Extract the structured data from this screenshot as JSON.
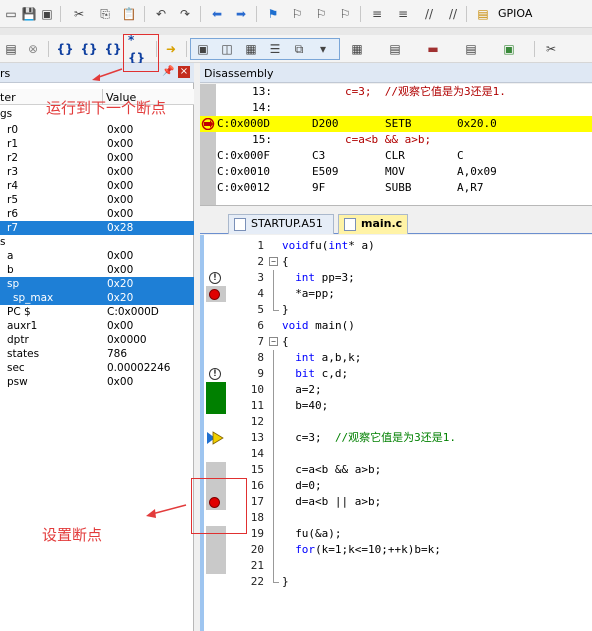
{
  "toolbar1": {
    "target_name": "GPIOA",
    "icons": [
      "new-file-icon",
      "save-icon",
      "save-all-icon",
      "cut-icon",
      "copy-icon",
      "paste-icon",
      "undo-icon",
      "redo-icon",
      "nav-back-icon",
      "nav-forward-icon",
      "bookmark-icon",
      "bookmark-prev-icon",
      "bookmark-next-icon",
      "bookmark-clear-icon",
      "indent-icon",
      "unindent-icon",
      "comment-icon",
      "uncomment-icon",
      "project-icon"
    ]
  },
  "toolbar2": {
    "icons": [
      "reset-icon",
      "stop-icon",
      "step-into-icon",
      "step-over-icon",
      "step-out-icon",
      "run-to-cursor-icon",
      "show-next-statement-icon",
      "command-window-icon",
      "disassembly-window-icon",
      "symbols-window-icon",
      "registers-window-icon",
      "call-stack-icon",
      "watch-window-icon",
      "memory-window-icon",
      "serial-window-icon",
      "logic-analyzer-icon",
      "trace-icon",
      "system-viewer-icon",
      "toolbox-icon"
    ],
    "step_symbols": [
      "{}",
      "{}",
      "{}",
      "*{}"
    ]
  },
  "registers": {
    "title": "rs",
    "col_name": "ter",
    "col_value": "Value",
    "section_label": "gs",
    "rows": [
      {
        "name": "r0",
        "value": "0x00",
        "sel": false,
        "indent": 7
      },
      {
        "name": "r1",
        "value": "0x00",
        "sel": false,
        "indent": 7
      },
      {
        "name": "r2",
        "value": "0x00",
        "sel": false,
        "indent": 7
      },
      {
        "name": "r3",
        "value": "0x00",
        "sel": false,
        "indent": 7
      },
      {
        "name": "r4",
        "value": "0x00",
        "sel": false,
        "indent": 7
      },
      {
        "name": "r5",
        "value": "0x00",
        "sel": false,
        "indent": 7
      },
      {
        "name": "r6",
        "value": "0x00",
        "sel": false,
        "indent": 7
      },
      {
        "name": "r7",
        "value": "0x28",
        "sel": true,
        "indent": 7
      },
      {
        "name": "s",
        "value": "",
        "sel": false,
        "indent": 0
      },
      {
        "name": "a",
        "value": "0x00",
        "sel": false,
        "indent": 7
      },
      {
        "name": "b",
        "value": "0x00",
        "sel": false,
        "indent": 7
      },
      {
        "name": "sp",
        "value": "0x20",
        "sel": true,
        "indent": 7
      },
      {
        "name": "sp_max",
        "value": "0x20",
        "sel": true,
        "indent": 13
      },
      {
        "name": "PC  $",
        "value": "C:0x000D",
        "sel": false,
        "indent": 7
      },
      {
        "name": "auxr1",
        "value": "0x00",
        "sel": false,
        "indent": 7
      },
      {
        "name": "dptr",
        "value": "0x0000",
        "sel": false,
        "indent": 7
      },
      {
        "name": "states",
        "value": "786",
        "sel": false,
        "indent": 7
      },
      {
        "name": "sec",
        "value": "0.00002246",
        "sel": false,
        "indent": 7
      },
      {
        "name": "psw",
        "value": "0x00",
        "sel": false,
        "indent": 7
      }
    ]
  },
  "disassembly": {
    "title": "Disassembly",
    "rows": [
      {
        "kind": "src",
        "ln": "13:",
        "text": "c=3;  //观察它值是为3还是1."
      },
      {
        "kind": "src",
        "ln": "14:",
        "text": ""
      },
      {
        "kind": "asm",
        "addr": "C:0x000D",
        "hex": "D200",
        "mn": "SETB",
        "op": "0x20.0",
        "cur": true
      },
      {
        "kind": "src",
        "ln": "15:",
        "text": "c=a<b && a>b;"
      },
      {
        "kind": "asm",
        "addr": "C:0x000F",
        "hex": "C3",
        "mn": "CLR",
        "op": "C",
        "cur": false
      },
      {
        "kind": "asm",
        "addr": "C:0x0010",
        "hex": "E509",
        "mn": "MOV",
        "op": "A,0x09",
        "cur": false
      },
      {
        "kind": "asm",
        "addr": "C:0x0012",
        "hex": "9F",
        "mn": "SUBB",
        "op": "A,R7",
        "cur": false
      }
    ]
  },
  "tabs": [
    {
      "label": "STARTUP.A51",
      "active": false
    },
    {
      "label": "main.c",
      "active": true
    }
  ],
  "code": [
    {
      "ln": "1",
      "html_parts": [
        [
          "kw",
          "void"
        ],
        [
          "",
          "fu("
        ],
        [
          "kw",
          "int"
        ],
        [
          "",
          "* a)"
        ]
      ],
      "mark": "",
      "cov": "",
      "fold": "",
      "indent": 0
    },
    {
      "ln": "2",
      "html_parts": [
        [
          "",
          "{"
        ]
      ],
      "mark": "",
      "cov": "",
      "fold": "open",
      "indent": 0
    },
    {
      "ln": "3",
      "html_parts": [
        [
          "kw",
          "int"
        ],
        [
          "",
          " pp=3;"
        ]
      ],
      "mark": "warn",
      "cov": "",
      "fold": "line",
      "indent": 2
    },
    {
      "ln": "4",
      "html_parts": [
        [
          "",
          "*a=pp;"
        ]
      ],
      "mark": "bp",
      "cov": "gray",
      "fold": "line",
      "indent": 2
    },
    {
      "ln": "5",
      "html_parts": [
        [
          "",
          "}"
        ]
      ],
      "mark": "",
      "cov": "",
      "fold": "end",
      "indent": 0
    },
    {
      "ln": "6",
      "html_parts": [
        [
          "kw",
          "void"
        ],
        [
          "",
          " main()"
        ]
      ],
      "mark": "",
      "cov": "",
      "fold": "",
      "indent": 0
    },
    {
      "ln": "7",
      "html_parts": [
        [
          "",
          "{"
        ]
      ],
      "mark": "",
      "cov": "",
      "fold": "open",
      "indent": 0
    },
    {
      "ln": "8",
      "html_parts": [
        [
          "kw",
          "int"
        ],
        [
          "",
          " a,b,k;"
        ]
      ],
      "mark": "",
      "cov": "",
      "fold": "line",
      "indent": 2
    },
    {
      "ln": "9",
      "html_parts": [
        [
          "kw",
          "bit"
        ],
        [
          "",
          " c,d;"
        ]
      ],
      "mark": "warn",
      "cov": "",
      "fold": "line",
      "indent": 2
    },
    {
      "ln": "10",
      "html_parts": [
        [
          "",
          "a=2;"
        ]
      ],
      "mark": "",
      "cov": "green",
      "fold": "line",
      "indent": 2
    },
    {
      "ln": "11",
      "html_parts": [
        [
          "",
          "b=40;"
        ]
      ],
      "mark": "",
      "cov": "green",
      "fold": "line",
      "indent": 2
    },
    {
      "ln": "12",
      "html_parts": [],
      "mark": "",
      "cov": "",
      "fold": "line",
      "indent": 2
    },
    {
      "ln": "13",
      "html_parts": [
        [
          "",
          "c=3;  "
        ],
        [
          "cm",
          "//观察它值是为3还是1."
        ]
      ],
      "mark": "cur",
      "cov": "",
      "fold": "line",
      "indent": 2
    },
    {
      "ln": "14",
      "html_parts": [],
      "mark": "",
      "cov": "",
      "fold": "line",
      "indent": 2
    },
    {
      "ln": "15",
      "html_parts": [
        [
          "",
          "c=a<b && a>b;"
        ]
      ],
      "mark": "",
      "cov": "gray",
      "fold": "line",
      "indent": 2
    },
    {
      "ln": "16",
      "html_parts": [
        [
          "",
          "d=0;"
        ]
      ],
      "mark": "",
      "cov": "gray",
      "fold": "line",
      "indent": 2
    },
    {
      "ln": "17",
      "html_parts": [
        [
          "",
          "d=a<b || a>b;"
        ]
      ],
      "mark": "bp",
      "cov": "gray",
      "fold": "line",
      "indent": 2
    },
    {
      "ln": "18",
      "html_parts": [],
      "mark": "",
      "cov": "",
      "fold": "line",
      "indent": 2
    },
    {
      "ln": "19",
      "html_parts": [
        [
          "",
          "fu(&a);"
        ]
      ],
      "mark": "",
      "cov": "gray",
      "fold": "line",
      "indent": 2
    },
    {
      "ln": "20",
      "html_parts": [
        [
          "kw",
          "for"
        ],
        [
          "",
          "(k=1;k<=10;++k)b=k;"
        ]
      ],
      "mark": "",
      "cov": "gray",
      "fold": "line",
      "indent": 2
    },
    {
      "ln": "21",
      "html_parts": [],
      "mark": "",
      "cov": "gray",
      "fold": "line",
      "indent": 2
    },
    {
      "ln": "22",
      "html_parts": [
        [
          "",
          "}"
        ]
      ],
      "mark": "",
      "cov": "",
      "fold": "end",
      "indent": 0
    }
  ],
  "annotations": {
    "run_to_next_bp": "运行到下一个断点",
    "set_breakpoint": "设置断点"
  },
  "colors": {
    "annotation_red": "#e23b3b",
    "selection_blue": "#1e7fd6",
    "current_line_yellow": "#ffff00",
    "breakpoint_red": "#e00000",
    "coverage_green": "#008000"
  }
}
